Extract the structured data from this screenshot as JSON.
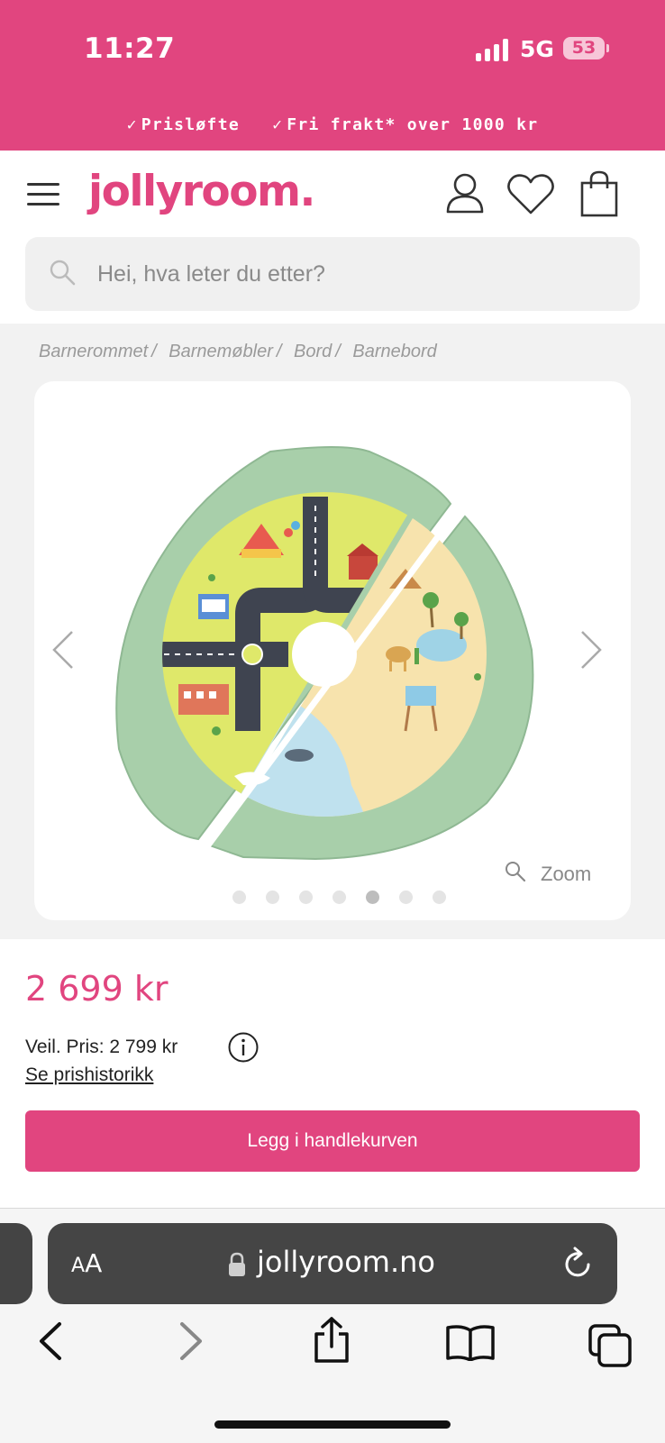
{
  "status_bar": {
    "time": "11:27",
    "network": "5G",
    "battery": "53"
  },
  "promo": {
    "items": [
      "Prisløfte",
      "Fri frakt* over 1000 kr"
    ]
  },
  "header": {
    "logo": "jollyroom."
  },
  "search": {
    "placeholder": "Hei, hva leter du etter?"
  },
  "breadcrumb": [
    "Barnerommet",
    "Barnemøbler",
    "Bord",
    "Barnebord"
  ],
  "gallery": {
    "zoom_label": "Zoom",
    "image_count": 7,
    "active_index": 4
  },
  "product": {
    "price": "2 699 kr",
    "recommended_price": "Veil. Pris: 2 799 kr",
    "price_history_link": "Se prishistorikk",
    "add_to_cart": "Legg i handlekurven"
  },
  "browser": {
    "domain": "jollyroom.no",
    "text_size_label": "A"
  },
  "colors": {
    "brand_pink": "#e1457f",
    "mat_green": "#a8cfaa",
    "land_yellow": "#dfe86a",
    "water_blue": "#bfe1ee",
    "sand": "#f7e3ad"
  }
}
